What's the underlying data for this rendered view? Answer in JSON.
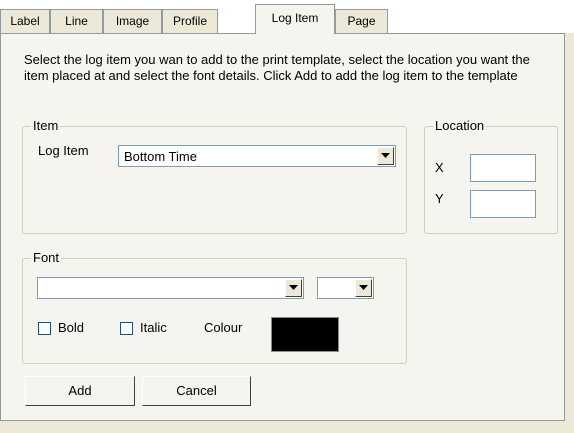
{
  "tabs": [
    {
      "label": "Label"
    },
    {
      "label": "Line"
    },
    {
      "label": "Image"
    },
    {
      "label": "Profile"
    },
    {
      "label": "Log Item",
      "active": true
    },
    {
      "label": "Page"
    }
  ],
  "instructions": "Select the log item you wan to add to the print template, select the location you want the item placed at and select the font details.  Click Add to add the log item to the template",
  "item_group": {
    "legend": "Item",
    "log_item_label": "Log Item",
    "log_item_value": "Bottom Time"
  },
  "location_group": {
    "legend": "Location",
    "x_label": "X",
    "y_label": "Y",
    "x_value": "",
    "y_value": ""
  },
  "font_group": {
    "legend": "Font",
    "font_name": "",
    "font_size": "",
    "bold_label": "Bold",
    "bold_checked": false,
    "italic_label": "Italic",
    "italic_checked": false,
    "colour_label": "Colour",
    "colour_value": "#000000"
  },
  "buttons": {
    "add": "Add",
    "cancel": "Cancel"
  },
  "colors": {
    "panel": "#f5f4ee",
    "tab_border": "#919b9c",
    "group_border": "#d0d0bf"
  }
}
